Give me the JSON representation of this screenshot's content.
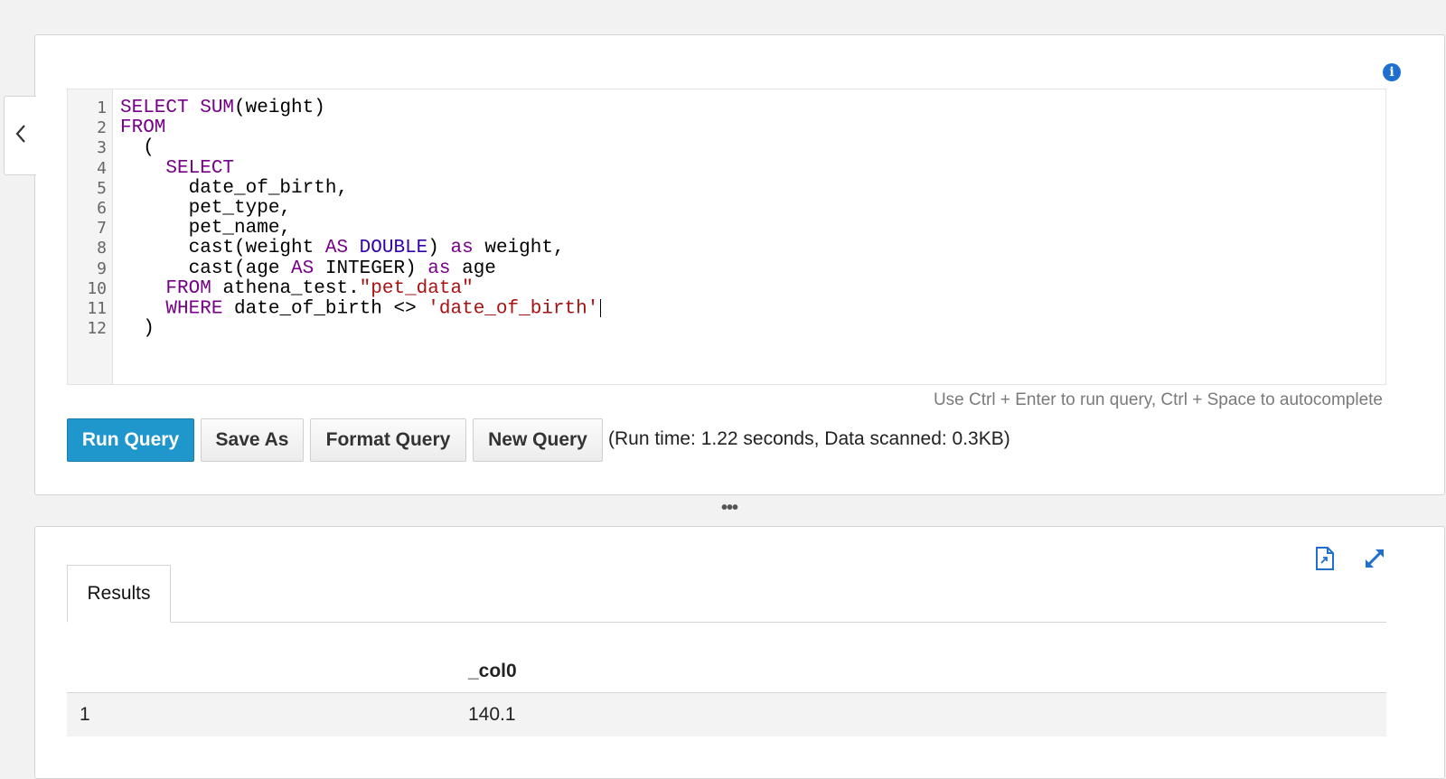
{
  "editor": {
    "line_numbers": [
      "1",
      "2",
      "3",
      "4",
      "5",
      "6",
      "7",
      "8",
      "9",
      "10",
      "11",
      "12"
    ],
    "lines": [
      [
        {
          "t": "SELECT ",
          "c": "kw"
        },
        {
          "t": "SUM",
          "c": "fn"
        },
        {
          "t": "(weight)",
          "c": ""
        }
      ],
      [
        {
          "t": "FROM",
          "c": "kw"
        }
      ],
      [
        {
          "t": "  (",
          "c": ""
        }
      ],
      [
        {
          "t": "    ",
          "c": ""
        },
        {
          "t": "SELECT",
          "c": "kw"
        }
      ],
      [
        {
          "t": "      date_of_birth,",
          "c": ""
        }
      ],
      [
        {
          "t": "      pet_type,",
          "c": ""
        }
      ],
      [
        {
          "t": "      pet_name,",
          "c": ""
        }
      ],
      [
        {
          "t": "      cast(weight ",
          "c": ""
        },
        {
          "t": "AS",
          "c": "kw"
        },
        {
          "t": " ",
          "c": ""
        },
        {
          "t": "DOUBLE",
          "c": "ty"
        },
        {
          "t": ") ",
          "c": ""
        },
        {
          "t": "as",
          "c": "kw"
        },
        {
          "t": " weight,",
          "c": ""
        }
      ],
      [
        {
          "t": "      cast(age ",
          "c": ""
        },
        {
          "t": "AS",
          "c": "kw"
        },
        {
          "t": " INTEGER) ",
          "c": ""
        },
        {
          "t": "as",
          "c": "kw"
        },
        {
          "t": " age",
          "c": ""
        }
      ],
      [
        {
          "t": "    ",
          "c": ""
        },
        {
          "t": "FROM",
          "c": "kw"
        },
        {
          "t": " athena_test.",
          "c": ""
        },
        {
          "t": "\"pet_data\"",
          "c": "str"
        }
      ],
      [
        {
          "t": "    ",
          "c": ""
        },
        {
          "t": "WHERE",
          "c": "kw"
        },
        {
          "t": " date_of_birth <> ",
          "c": ""
        },
        {
          "t": "'date_of_birth'",
          "c": "str"
        }
      ],
      [
        {
          "t": "  )",
          "c": ""
        }
      ]
    ],
    "hint": "Use Ctrl + Enter to run query, Ctrl + Space to autocomplete"
  },
  "toolbar": {
    "run_label": "Run Query",
    "save_as_label": "Save As",
    "format_label": "Format Query",
    "new_label": "New Query",
    "run_stats": "(Run time: 1.22 seconds, Data scanned: 0.3KB)"
  },
  "drag_handle": "•••",
  "results": {
    "tab_label": "Results",
    "columns": [
      "",
      "_col0"
    ],
    "rows": [
      [
        "1",
        "140.1"
      ]
    ]
  },
  "icons": {
    "collapse": "chevron-left-icon",
    "info": "info-icon",
    "download": "download-csv-icon",
    "expand": "expand-icon"
  },
  "colors": {
    "primary_button": "#1f97cc",
    "keyword": "#770088",
    "type": "#3300aa",
    "string": "#aa1111"
  }
}
